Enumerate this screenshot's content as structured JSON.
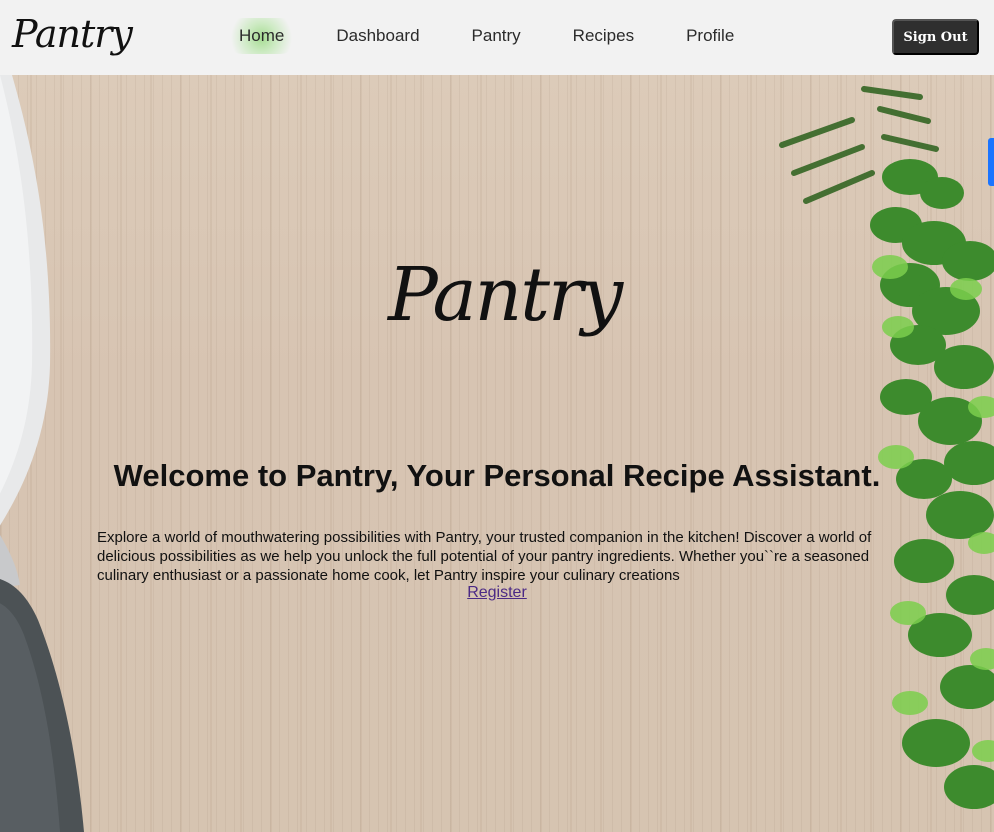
{
  "header": {
    "brand": "Pantry",
    "nav": [
      {
        "label": "Home",
        "active": true
      },
      {
        "label": "Dashboard",
        "active": false
      },
      {
        "label": "Pantry",
        "active": false
      },
      {
        "label": "Recipes",
        "active": false
      },
      {
        "label": "Profile",
        "active": false
      }
    ],
    "sign_out_label": "Sign Out"
  },
  "hero": {
    "brand": "Pantry",
    "title": "Welcome to Pantry, Your Personal Recipe Assistant.",
    "description": "Explore a world of mouthwatering possibilities with Pantry, your trusted companion in the kitchen! Discover a world of delicious possibilities as we help you unlock the full potential of your pantry ingredients. Whether you``re a seasoned culinary enthusiast or a passionate home cook, let Pantry inspire your culinary creations",
    "register_label": "Register"
  },
  "colors": {
    "header_bg": "#f2f2f2",
    "nav_active_glow": "#a2db8d",
    "signout_bg": "#2f2f2f",
    "link": "#4b2a86",
    "right_edge_accent": "#1b74ff"
  },
  "icons": {
    "brand_logo": "script-wordmark",
    "hero_logo": "script-wordmark"
  }
}
